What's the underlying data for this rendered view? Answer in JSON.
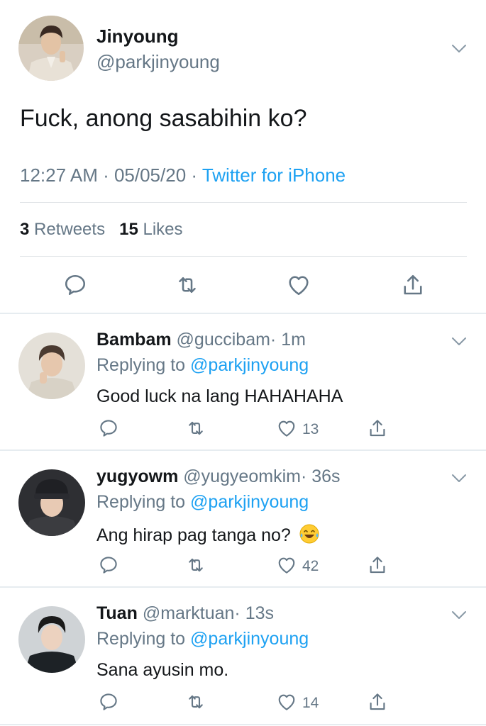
{
  "main_tweet": {
    "name": "Jinyoung",
    "handle": "@parkjinyoung",
    "text": "Fuck, anong sasabihin ko?",
    "time": "12:27 AM · 05/05/20 · ",
    "source": "Twitter for iPhone",
    "retweets_count": "3",
    "retweets_label": "Retweets",
    "likes_count": "15",
    "likes_label": "Likes"
  },
  "replies": [
    {
      "name": "Bambam",
      "handle": "@guccibam",
      "time": "· 1m",
      "replying_label": "Replying to",
      "replying_to": "@parkjinyoung",
      "text": "Good luck na lang HAHAHAHA",
      "likes": "13"
    },
    {
      "name": "yugyowm",
      "handle": "@yugyeomkim",
      "time": "· 36s",
      "replying_label": "Replying to",
      "replying_to": "@parkjinyoung",
      "text": "Ang hirap pag tanga no?",
      "emoji": "face-with-tears-of-joy",
      "likes": "42"
    },
    {
      "name": "Tuan",
      "handle": "@marktuan",
      "time": "· 13s",
      "replying_label": "Replying to",
      "replying_to": "@parkjinyoung",
      "text": "Sana ayusin mo.",
      "likes": "14"
    }
  ],
  "colors": {
    "link": "#1da1f2",
    "secondary_text": "#657786",
    "primary_text": "#14171a",
    "divider": "#e6ecf0"
  },
  "icons": {
    "reply": "reply-icon",
    "retweet": "retweet-icon",
    "like": "heart-icon",
    "share": "share-icon",
    "menu": "chevron-down-icon"
  }
}
